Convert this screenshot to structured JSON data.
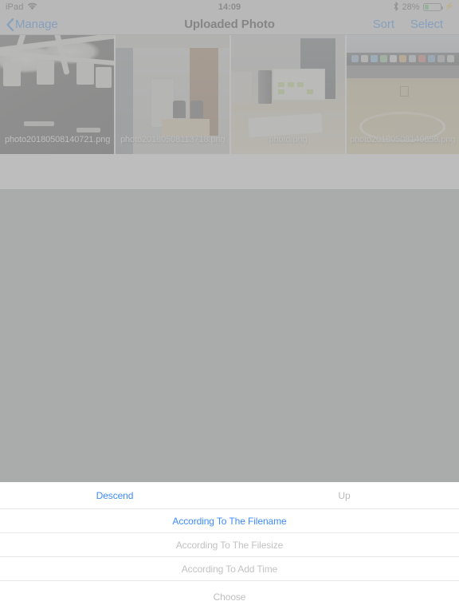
{
  "status_bar": {
    "device": "iPad",
    "wifi_icon": "wifi-icon",
    "time": "14:09",
    "bluetooth_icon": "bluetooth-icon",
    "battery_percent": "28%",
    "battery_level": 28,
    "charging_icon": "lightning-bolt-icon",
    "battery_color": "#4cd263"
  },
  "nav_bar": {
    "back_icon": "chevron-left-icon",
    "back_label": "Manage",
    "title": "Uploaded Photo",
    "sort_label": "Sort",
    "select_label": "Select",
    "accent_color": "#067aff"
  },
  "photos": [
    {
      "filename": "photo20180508140721.png",
      "align": "left"
    },
    {
      "filename": "photo20180508113718.png",
      "align": "left"
    },
    {
      "filename": "photo.png",
      "align": "center"
    },
    {
      "filename": "photo20180508140658.png",
      "align": "right"
    }
  ],
  "sort_sheet": {
    "order": {
      "descend_label": "Descend",
      "descend_active": true,
      "up_label": "Up",
      "up_active": false
    },
    "options": [
      {
        "label": "According To The Filename",
        "active": true
      },
      {
        "label": "According To The Filesize",
        "active": false
      },
      {
        "label": "According To Add Time",
        "active": false
      }
    ],
    "confirm_label": "Choose",
    "active_color": "#3d8bfd",
    "inactive_color": "#bdbdbd"
  }
}
